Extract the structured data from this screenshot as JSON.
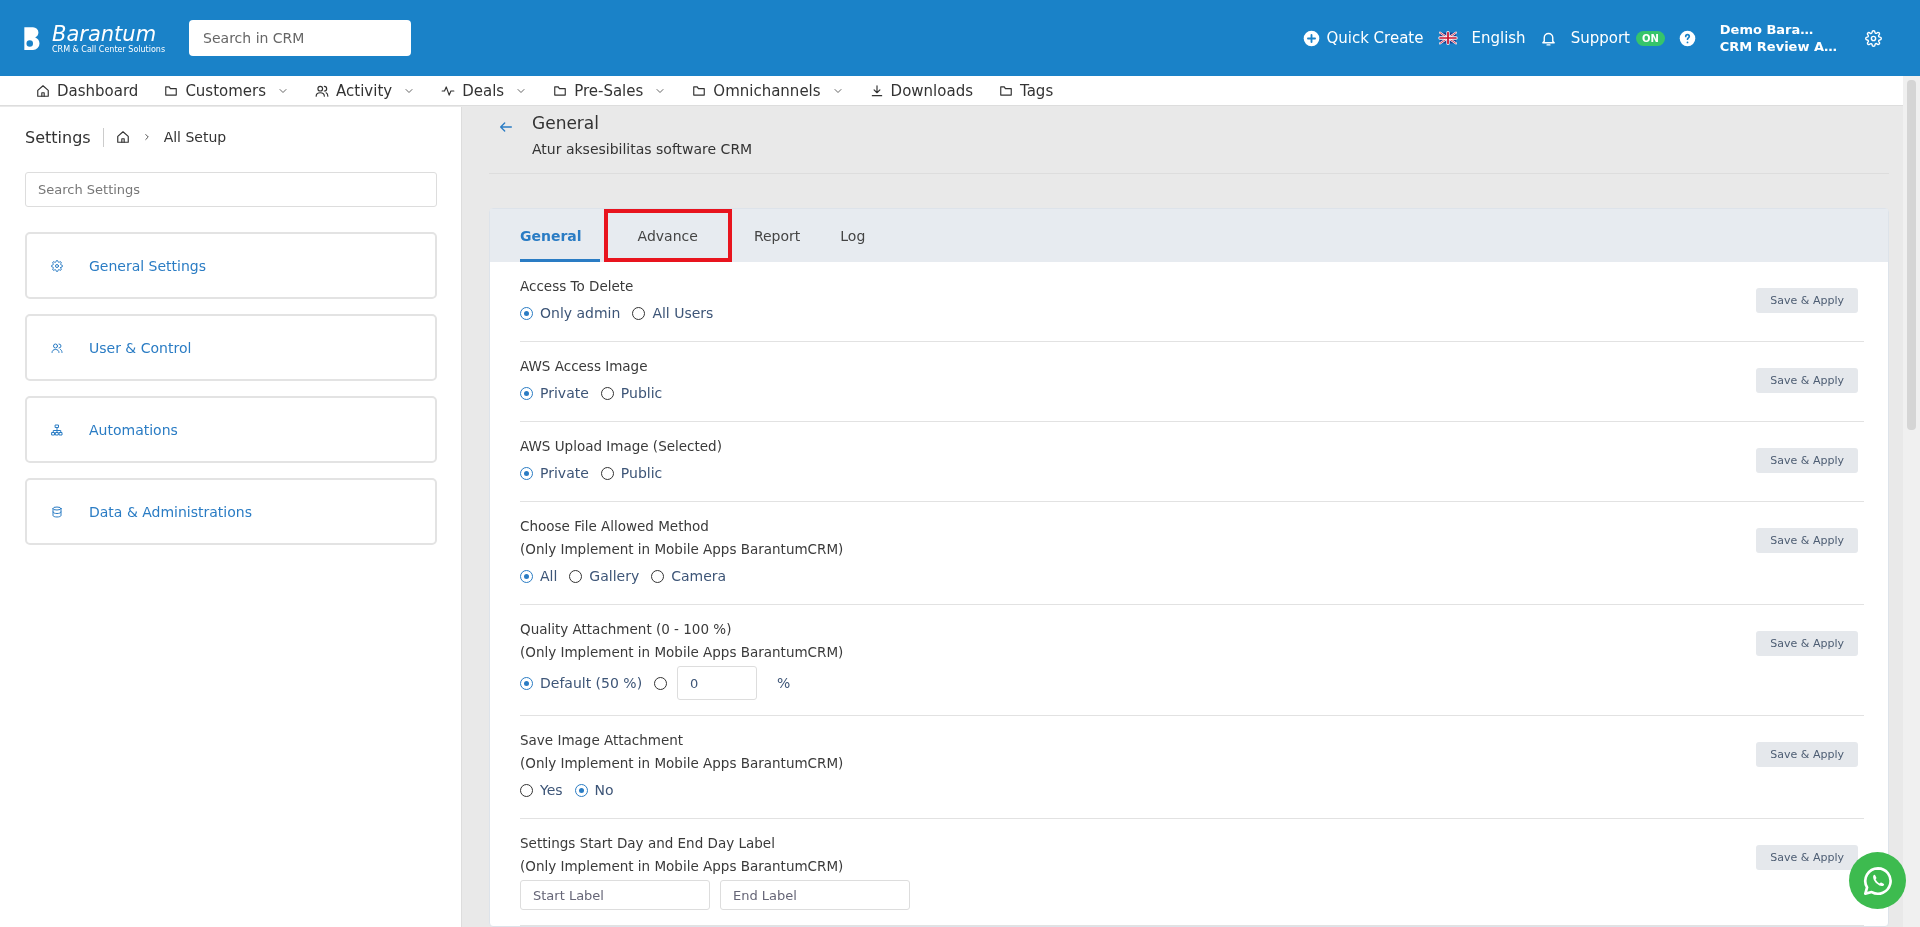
{
  "header": {
    "logo": {
      "name": "Barantum",
      "tagline": "CRM & Call Center Solutions"
    },
    "search": {
      "placeholder": "Search in CRM"
    },
    "quick_create": "Quick Create",
    "language": "English",
    "support": {
      "label": "Support",
      "badge": "ON"
    },
    "user": {
      "name": "Demo Bara…",
      "company": "CRM Review A…"
    }
  },
  "nav": [
    {
      "label": "Dashboard",
      "dropdown": false
    },
    {
      "label": "Customers",
      "dropdown": true
    },
    {
      "label": "Activity",
      "dropdown": true
    },
    {
      "label": "Deals",
      "dropdown": true
    },
    {
      "label": "Pre-Sales",
      "dropdown": true
    },
    {
      "label": "Omnichannels",
      "dropdown": true
    },
    {
      "label": "Downloads",
      "dropdown": false
    },
    {
      "label": "Tags",
      "dropdown": false
    }
  ],
  "sidebar": {
    "title": "Settings",
    "breadcrumb": "All Setup",
    "search": {
      "placeholder": "Search Settings"
    },
    "items": [
      "General Settings",
      "User & Control",
      "Automations",
      "Data & Administrations"
    ]
  },
  "content": {
    "title": "General",
    "subtitle": "Atur aksesibilitas software CRM",
    "tabs": [
      {
        "label": "General",
        "selected": true,
        "highlighted": false
      },
      {
        "label": "Advance",
        "selected": false,
        "highlighted": true
      },
      {
        "label": "Report",
        "selected": false,
        "highlighted": false
      },
      {
        "label": "Log",
        "selected": false,
        "highlighted": false
      }
    ],
    "rows": [
      {
        "lines": [
          "Access To Delete"
        ],
        "controls": [
          {
            "kind": "radio",
            "label": "Only admin",
            "selected": true
          },
          {
            "kind": "radio",
            "label": "All Users",
            "selected": false
          }
        ],
        "button": "Save & Apply"
      },
      {
        "lines": [
          "AWS Access Image"
        ],
        "controls": [
          {
            "kind": "radio",
            "label": "Private",
            "selected": true
          },
          {
            "kind": "radio",
            "label": "Public",
            "selected": false
          }
        ],
        "button": "Save & Apply"
      },
      {
        "lines": [
          "AWS Upload Image (Selected)"
        ],
        "controls": [
          {
            "kind": "radio",
            "label": "Private",
            "selected": true
          },
          {
            "kind": "radio",
            "label": "Public",
            "selected": false
          }
        ],
        "button": "Save & Apply"
      },
      {
        "lines": [
          "Choose File Allowed Method",
          "(Only Implement in Mobile Apps BarantumCRM)"
        ],
        "controls": [
          {
            "kind": "radio",
            "label": "All",
            "selected": true
          },
          {
            "kind": "radio",
            "label": "Gallery",
            "selected": false
          },
          {
            "kind": "radio",
            "label": "Camera",
            "selected": false
          }
        ],
        "button": "Save & Apply"
      },
      {
        "lines": [
          "Quality Attachment (0 - 100 %)",
          "(Only Implement in Mobile Apps BarantumCRM)"
        ],
        "controls": [
          {
            "kind": "radio",
            "label": "Default (50 %)",
            "selected": true
          },
          {
            "kind": "radio",
            "selected": false
          },
          {
            "kind": "input",
            "value": "0"
          },
          {
            "kind": "suffix",
            "text": "%"
          }
        ],
        "button": "Save & Apply"
      },
      {
        "lines": [
          "Save Image Attachment",
          "(Only Implement in Mobile Apps BarantumCRM)"
        ],
        "controls": [
          {
            "kind": "radio",
            "label": "Yes",
            "selected": false
          },
          {
            "kind": "radio",
            "label": "No",
            "selected": true
          }
        ],
        "button": "Save & Apply"
      },
      {
        "lines": [
          "Settings Start Day and End Day Label",
          "(Only Implement in Mobile Apps BarantumCRM)"
        ],
        "controls": [
          {
            "kind": "field",
            "placeholder": "Start Label"
          },
          {
            "kind": "field",
            "placeholder": "End Label"
          }
        ],
        "button": "Save & Apply"
      }
    ]
  }
}
